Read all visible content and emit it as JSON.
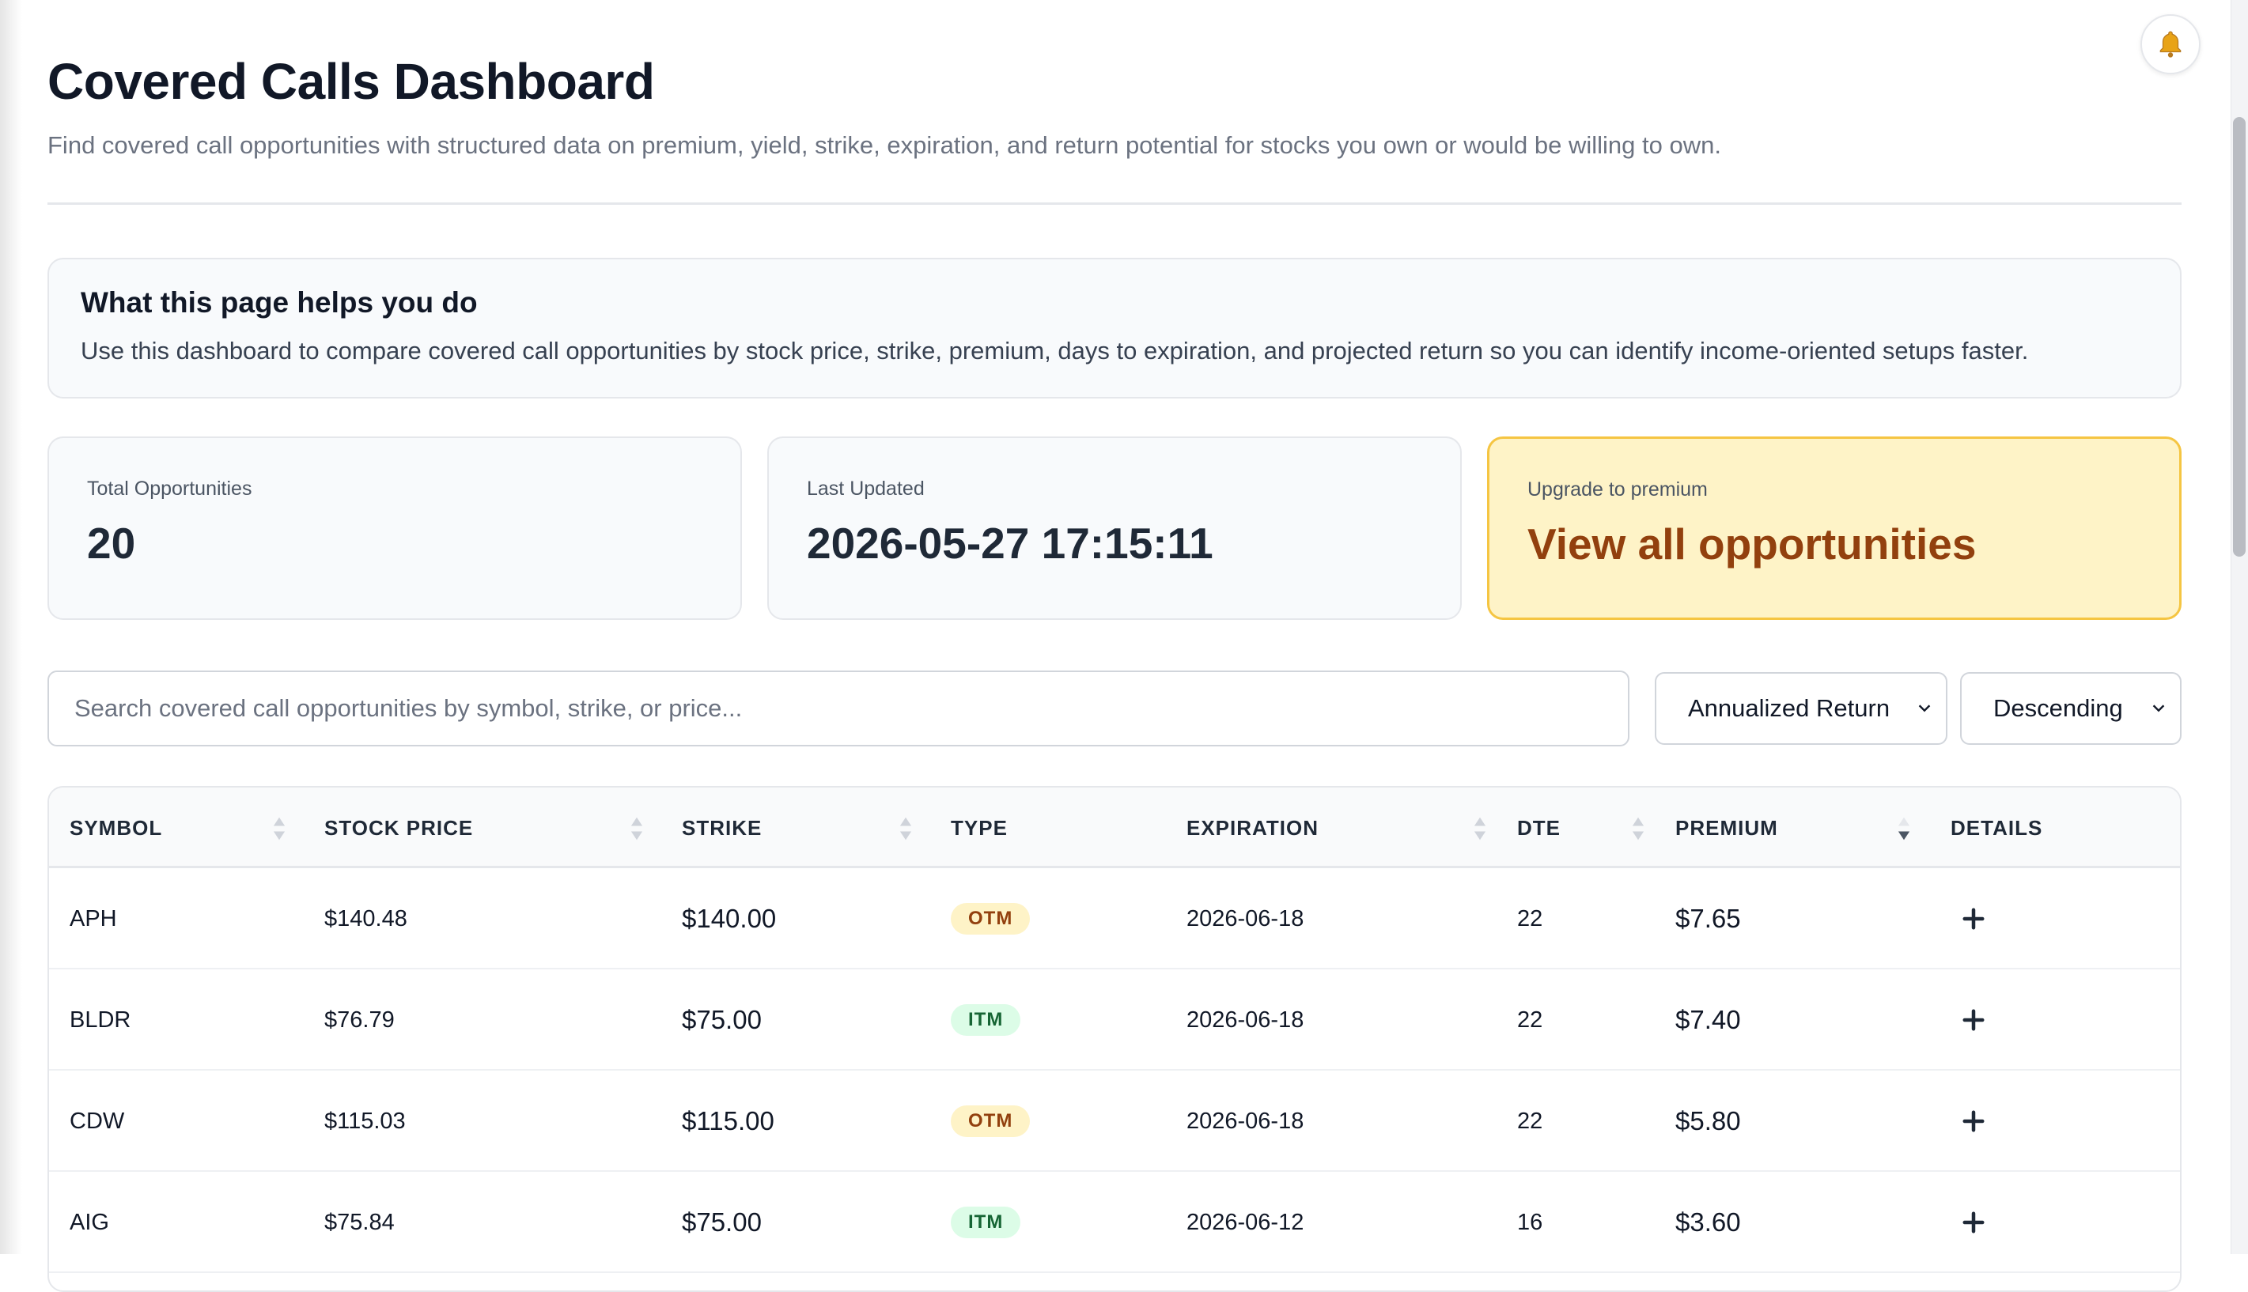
{
  "header": {
    "title": "Covered Calls Dashboard",
    "subtitle": "Find covered call opportunities with structured data on premium, yield, strike, expiration, and return potential for stocks you own or would be willing to own."
  },
  "info": {
    "title": "What this page helps you do",
    "text": "Use this dashboard to compare covered call opportunities by stock price, strike, premium, days to expiration, and projected return so you can identify income-oriented setups faster."
  },
  "stats": {
    "total_label": "Total Opportunities",
    "total_value": "20",
    "updated_label": "Last Updated",
    "updated_value": "2026-05-27 17:15:11",
    "premium_label": "Upgrade to premium",
    "premium_value": "View all opportunities"
  },
  "controls": {
    "search_placeholder": "Search covered call opportunities by symbol, strike, or price...",
    "sort_field": "Annualized Return",
    "sort_order": "Descending"
  },
  "table": {
    "columns": [
      "SYMBOL",
      "STOCK PRICE",
      "STRIKE",
      "TYPE",
      "EXPIRATION",
      "DTE",
      "PREMIUM",
      "DETAILS"
    ],
    "rows": [
      {
        "symbol": "APH",
        "price": "$140.48",
        "strike": "$140.00",
        "type": "OTM",
        "expiration": "2026-06-18",
        "dte": "22",
        "premium": "$7.65"
      },
      {
        "symbol": "BLDR",
        "price": "$76.79",
        "strike": "$75.00",
        "type": "ITM",
        "expiration": "2026-06-18",
        "dte": "22",
        "premium": "$7.40"
      },
      {
        "symbol": "CDW",
        "price": "$115.03",
        "strike": "$115.00",
        "type": "OTM",
        "expiration": "2026-06-18",
        "dte": "22",
        "premium": "$5.80"
      },
      {
        "symbol": "AIG",
        "price": "$75.84",
        "strike": "$75.00",
        "type": "ITM",
        "expiration": "2026-06-12",
        "dte": "16",
        "premium": "$3.60"
      }
    ]
  },
  "icons": {
    "bell": "bell-icon",
    "sort": "sort-icon",
    "chevron": "chevron-down-icon",
    "expand": "plus-icon"
  },
  "colors": {
    "premium_bg": "#fef3c7",
    "premium_border": "#f5c542",
    "premium_text": "#92400e",
    "itm_bg": "#dcfce7",
    "itm_text": "#166534",
    "otm_bg": "#fef3c7",
    "otm_text": "#92400e"
  }
}
